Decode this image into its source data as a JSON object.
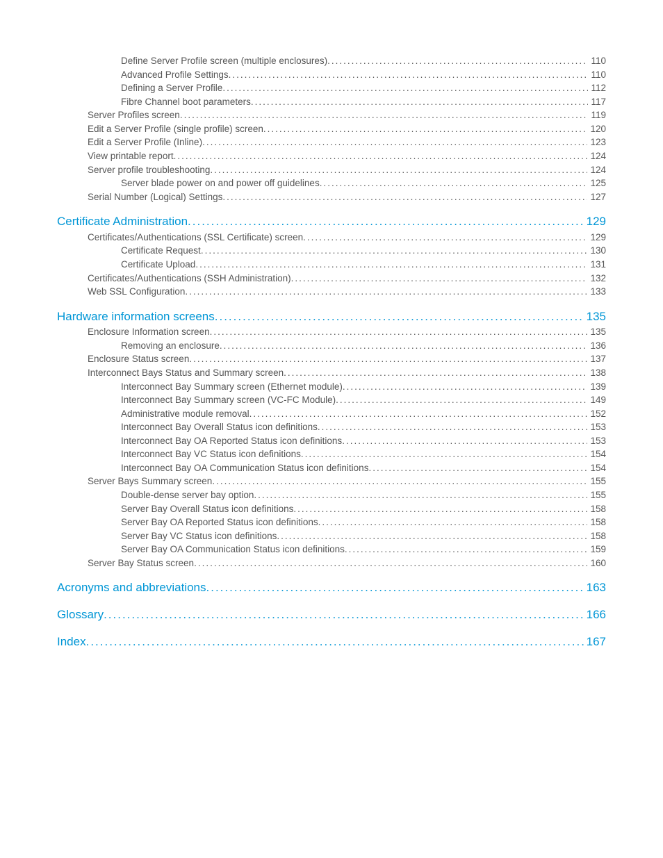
{
  "toc": [
    {
      "level": "lvl2",
      "label": "Define Server Profile screen (multiple enclosures)",
      "page": "110"
    },
    {
      "level": "lvl2",
      "label": "Advanced Profile Settings",
      "page": "110"
    },
    {
      "level": "lvl2",
      "label": "Defining a Server Profile",
      "page": "112"
    },
    {
      "level": "lvl2",
      "label": "Fibre Channel boot parameters",
      "page": "117"
    },
    {
      "level": "lvl1",
      "label": "Server Profiles screen",
      "page": "119"
    },
    {
      "level": "lvl1",
      "label": "Edit a Server Profile (single profile) screen",
      "page": "120"
    },
    {
      "level": "lvl1",
      "label": "Edit a Server Profile (Inline)",
      "page": "123"
    },
    {
      "level": "lvl1",
      "label": "View printable report",
      "page": "124"
    },
    {
      "level": "lvl1",
      "label": "Server profile troubleshooting",
      "page": "124"
    },
    {
      "level": "lvl2",
      "label": "Server blade power on and power off guidelines",
      "page": "125"
    },
    {
      "level": "lvl1",
      "label": "Serial Number (Logical) Settings",
      "page": "127"
    },
    {
      "level": "lvl-heading",
      "label": "Certificate Administration",
      "page": "129"
    },
    {
      "level": "lvl1",
      "label": "Certificates/Authentications (SSL Certificate) screen",
      "page": "129"
    },
    {
      "level": "lvl2",
      "label": "Certificate Request",
      "page": "130"
    },
    {
      "level": "lvl2",
      "label": "Certificate Upload",
      "page": "131"
    },
    {
      "level": "lvl1",
      "label": "Certificates/Authentications (SSH Administration)",
      "page": "132"
    },
    {
      "level": "lvl1",
      "label": "Web SSL Configuration",
      "page": "133"
    },
    {
      "level": "lvl-heading",
      "label": "Hardware information screens",
      "page": "135"
    },
    {
      "level": "lvl1",
      "label": "Enclosure Information screen",
      "page": "135"
    },
    {
      "level": "lvl2",
      "label": "Removing an enclosure",
      "page": "136"
    },
    {
      "level": "lvl1",
      "label": "Enclosure Status screen",
      "page": "137"
    },
    {
      "level": "lvl1",
      "label": "Interconnect Bays Status and Summary screen",
      "page": "138"
    },
    {
      "level": "lvl2",
      "label": "Interconnect Bay Summary screen (Ethernet module)",
      "page": "139"
    },
    {
      "level": "lvl2",
      "label": "Interconnect Bay Summary screen (VC-FC Module)",
      "page": "149"
    },
    {
      "level": "lvl2",
      "label": "Administrative module removal",
      "page": "152"
    },
    {
      "level": "lvl2",
      "label": "Interconnect Bay Overall Status icon definitions",
      "page": "153"
    },
    {
      "level": "lvl2",
      "label": "Interconnect Bay OA Reported Status icon definitions",
      "page": "153"
    },
    {
      "level": "lvl2",
      "label": "Interconnect Bay VC Status icon definitions",
      "page": "154"
    },
    {
      "level": "lvl2",
      "label": "Interconnect Bay OA Communication Status icon definitions",
      "page": "154"
    },
    {
      "level": "lvl1",
      "label": "Server Bays Summary screen",
      "page": "155"
    },
    {
      "level": "lvl2",
      "label": "Double-dense server bay option",
      "page": "155"
    },
    {
      "level": "lvl2",
      "label": "Server Bay Overall Status icon definitions",
      "page": "158"
    },
    {
      "level": "lvl2",
      "label": "Server Bay OA Reported Status icon definitions",
      "page": "158"
    },
    {
      "level": "lvl2",
      "label": "Server Bay VC Status icon definitions",
      "page": "158"
    },
    {
      "level": "lvl2",
      "label": "Server Bay OA Communication Status icon definitions",
      "page": "159"
    },
    {
      "level": "lvl1",
      "label": "Server Bay Status screen",
      "page": "160"
    },
    {
      "level": "lvl-heading",
      "label": "Acronyms and abbreviations",
      "page": "163"
    },
    {
      "level": "lvl-heading",
      "label": "Glossary",
      "page": "166"
    },
    {
      "level": "lvl-heading",
      "label": "Index",
      "page": "167"
    }
  ]
}
